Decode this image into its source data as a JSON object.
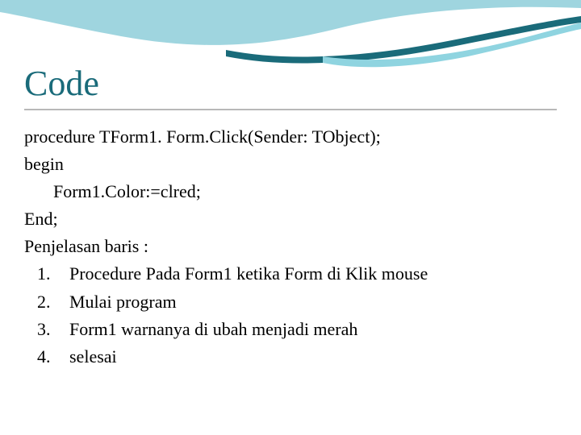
{
  "title": "Code",
  "code": {
    "line1": "procedure TForm1. Form.Click(Sender: TObject);",
    "line2": "begin",
    "line3": "Form1.Color:=clred;",
    "line4": "End;"
  },
  "explain_heading": "Penjelasan baris :",
  "list": {
    "n1": "1.",
    "t1": "Procedure Pada Form1 ketika Form di Klik mouse",
    "n2": "2.",
    "t2": "Mulai program",
    "n3": "3.",
    "t3": "Form1 warnanya di ubah menjadi merah",
    "n4": "4.",
    "t4": "selesai"
  }
}
